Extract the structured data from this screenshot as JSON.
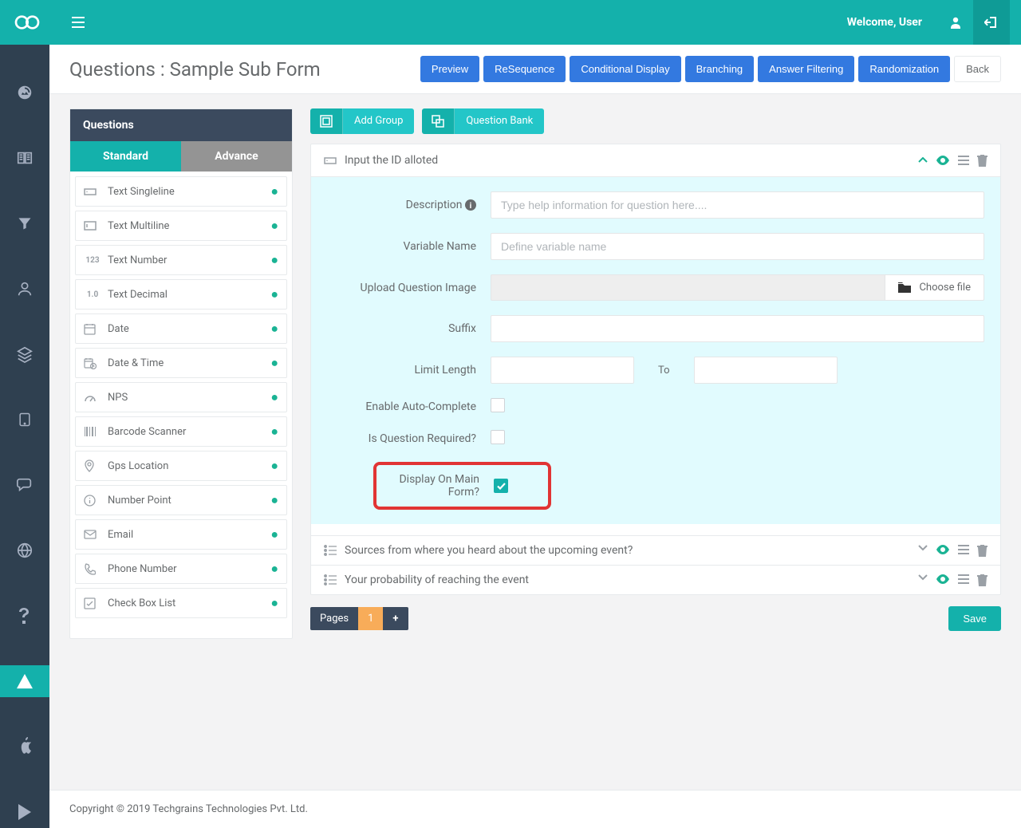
{
  "topbar": {
    "welcome": "Welcome, User"
  },
  "page": {
    "title": "Questions : Sample Sub Form"
  },
  "header_actions": {
    "preview": "Preview",
    "resequence": "ReSequence",
    "conditional": "Conditional Display",
    "branching": "Branching",
    "filtering": "Answer Filtering",
    "randomization": "Randomization",
    "back": "Back"
  },
  "left": {
    "header": "Questions",
    "tab_standard": "Standard",
    "tab_advance": "Advance",
    "types": [
      "Text Singleline",
      "Text Multiline",
      "Text Number",
      "Text Decimal",
      "Date",
      "Date & Time",
      "NPS",
      "Barcode Scanner",
      "Gps Location",
      "Number Point",
      "Email",
      "Phone Number",
      "Check Box List"
    ]
  },
  "toolbar": {
    "add_group": "Add Group",
    "question_bank": "Question Bank"
  },
  "question": {
    "title": "Input the ID alloted",
    "labels": {
      "description": "Description",
      "variable": "Variable Name",
      "upload": "Upload Question Image",
      "suffix": "Suffix",
      "limit": "Limit Length",
      "to": "To",
      "autocomplete": "Enable Auto-Complete",
      "required": "Is Question Required?",
      "display_main": "Display On Main Form?"
    },
    "placeholders": {
      "description": "Type help information for question here....",
      "variable": "Define variable name"
    },
    "choose_file": "Choose file"
  },
  "collapsed": [
    "Sources from where you heard about the upcoming event?",
    "Your probability of reaching the event"
  ],
  "pager": {
    "label": "Pages",
    "num": "1",
    "add": "+"
  },
  "save": "Save",
  "footer": "Copyright © 2019 Techgrains Technologies Pvt. Ltd."
}
